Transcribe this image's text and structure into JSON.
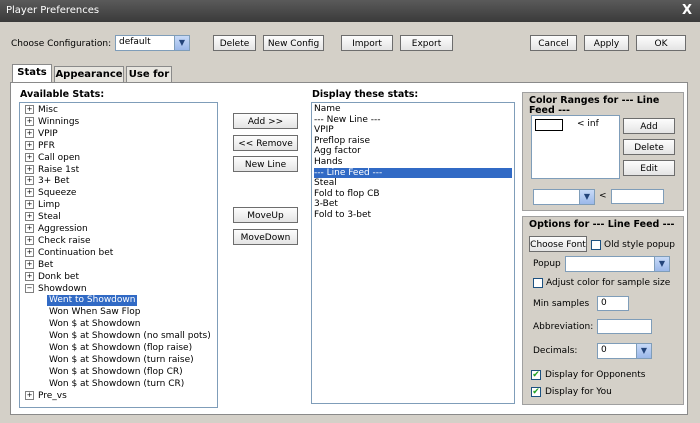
{
  "window": {
    "title": "Player Preferences",
    "close_glyph": "X"
  },
  "top": {
    "config_label": "Choose Configuration:",
    "config_value": "default",
    "delete": "Delete",
    "new_config": "New Config",
    "import": "Import",
    "export": "Export",
    "cancel": "Cancel",
    "apply": "Apply",
    "ok": "OK"
  },
  "tabs": [
    {
      "label": "Stats",
      "active": true
    },
    {
      "label": "Appearance",
      "active": false
    },
    {
      "label": "Use for",
      "active": false
    }
  ],
  "available": {
    "heading": "Available Stats:",
    "groups": [
      "Misc",
      "Winnings",
      "VPIP",
      "PFR",
      "Call open",
      "Raise 1st",
      "3+ Bet",
      "Squeeze",
      "Limp",
      "Steal",
      "Aggression",
      "Check raise",
      "Continuation bet",
      "Bet",
      "Donk bet",
      "Showdown"
    ],
    "showdown_children": [
      "Went to Showdown",
      "Won When Saw Flop",
      "Won $ at Showdown",
      "Won $ at Showdown (no small pots)",
      "Won $ at Showdown (flop raise)",
      "Won $ at Showdown (turn raise)",
      "Won $ at Showdown (flop CR)",
      "Won $ at Showdown (turn CR)"
    ],
    "selected_child": "Went to Showdown",
    "last_group": "Pre_vs"
  },
  "middle_buttons": {
    "add": "Add >>",
    "remove": "<< Remove",
    "new_line": "New Line",
    "move_up": "MoveUp",
    "move_down": "MoveDown"
  },
  "display": {
    "heading": "Display these stats:",
    "items": [
      "Name",
      "--- New Line ---",
      "VPIP",
      "Preflop raise",
      "Agg factor",
      "Hands",
      "--- Line Feed ---",
      "Steal",
      "Fold to flop CB",
      "3-Bet",
      "Fold to 3-bet"
    ],
    "selected": "--- Line Feed ---"
  },
  "color_ranges": {
    "title_line1": "Color Ranges for --- Line",
    "title_line2": "Feed ---",
    "range_text": "< inf",
    "add": "Add",
    "delete": "Delete",
    "edit": "Edit",
    "lt": "<"
  },
  "options": {
    "title": "Options for --- Line Feed ---",
    "choose_font": "Choose Font",
    "old_style_popup": "Old style popup",
    "popup_label": "Popup",
    "adjust_color": "Adjust color for sample size",
    "min_samples_label": "Min samples",
    "min_samples_value": "0",
    "abbreviation_label": "Abbreviation:",
    "decimals_label": "Decimals:",
    "decimals_value": "0",
    "display_opponents": "Display for Opponents",
    "display_you": "Display for You",
    "check_glyph": "✔"
  },
  "icons": {
    "plus": "+",
    "minus": "−",
    "dropdown": "▼"
  }
}
